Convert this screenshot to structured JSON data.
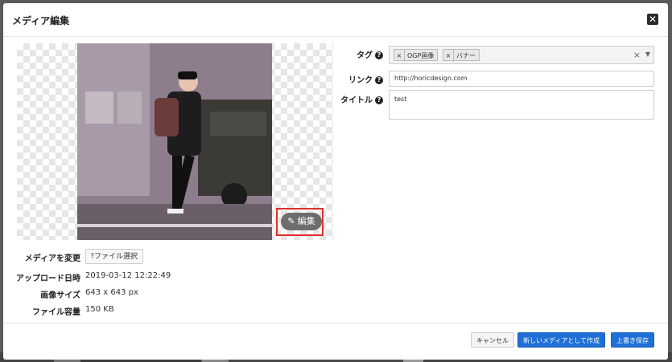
{
  "modal": {
    "title": "メディア編集",
    "close_icon": "close-icon"
  },
  "preview": {
    "edit_label": "編集",
    "edit_icon": "pencil-icon"
  },
  "meta": {
    "change_label": "メディアを変更",
    "file_button": "ファイル選択",
    "upload_label": "アップロード日時",
    "upload_value": "2019-03-12 12:22:49",
    "size_label": "画像サイズ",
    "size_value": "643 x 643 px",
    "filesize_label": "ファイル容量",
    "filesize_value": "150 KB"
  },
  "form": {
    "tag_label": "タグ",
    "tags": [
      "OGP画像",
      "バナー"
    ],
    "link_label": "リンク",
    "link_value": "http://horicdesign.com",
    "title_label": "タイトル",
    "title_value": "test"
  },
  "footer": {
    "cancel": "キャンセル",
    "create_new": "新しいメディアとして作成",
    "overwrite": "上書き保存"
  },
  "colors": {
    "primary": "#1f6fd6",
    "highlight": "#e0302a"
  }
}
